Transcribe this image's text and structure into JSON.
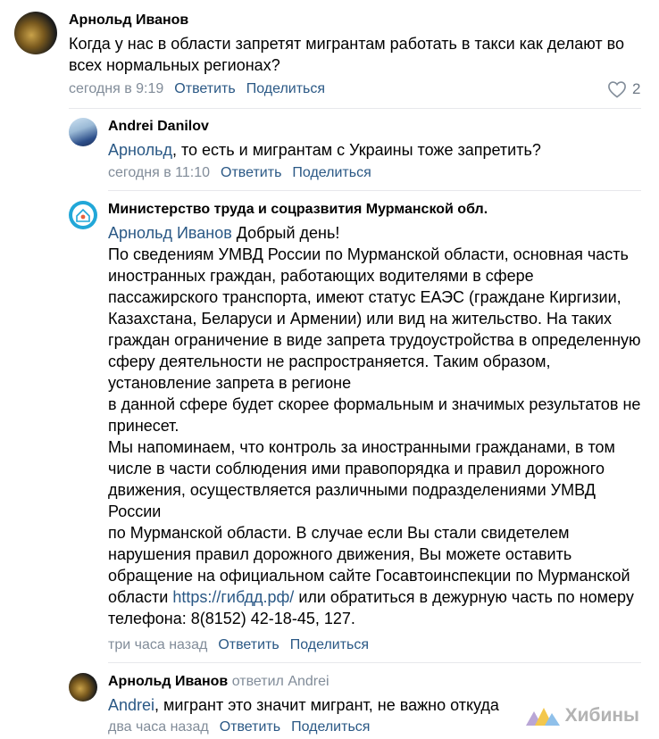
{
  "comments": [
    {
      "author": "Арнольд Иванов",
      "text": "Когда у нас в области запретят мигрантам работать в такси как делают во всех нормальных регионах?",
      "time": "сегодня в 9:19",
      "reply_label": "Ответить",
      "share_label": "Поделиться",
      "likes": "2"
    },
    {
      "author": "Andrei Danilov",
      "mention": "Арнольд",
      "text": ", то есть и мигрантам с Украины тоже запретить?",
      "time": "сегодня в 11:10",
      "reply_label": "Ответить",
      "share_label": "Поделиться"
    },
    {
      "author": "Министерство труда и соцразвития Мурманской обл.",
      "mention": "Арнольд Иванов",
      "greeting": " Добрый день!",
      "para1": "По сведениям УМВД России по Мурманской области, основная часть иностранных граждан, работающих водителями в сфере пассажирского транспорта, имеют статус ЕАЭС (граждане Киргизии, Казахстана, Беларуси и Армении) или вид на жительство. На таких граждан ограничение в виде запрета трудоустройства в определенную сферу деятельности не распространяется. Таким образом, установление запрета в регионе",
      "para2": "в данной сфере будет скорее формальным и значимых результатов не принесет.",
      "para3": "Мы напоминаем, что контроль за иностранными гражданами, в том числе в части соблюдения ими правопорядка и правил дорожного движения, осуществляется различными подразделениями УМВД России",
      "para4_a": "по Мурманской области. В случае если Вы стали свидетелем нарушения правил дорожного движения, Вы можете оставить обращение на официальном сайте Госавтоинспекции по Мурманской области ",
      "para4_link": "https://гибдд.рф/",
      "para4_b": " или обратиться в дежурную часть по номеру телефона: 8(8152) 42-18-45, 127.",
      "time": "три часа назад",
      "reply_label": "Ответить",
      "share_label": "Поделиться"
    },
    {
      "author": "Арнольд Иванов",
      "replied_to": "ответил Andrei",
      "mention": "Andrei",
      "text": ", мигрант это значит мигрант, не важно откуда",
      "time": "два часа назад",
      "reply_label": "Ответить",
      "share_label": "Поделиться"
    }
  ],
  "watermark": "Хибины",
  "colors": {
    "link": "#2a5885",
    "meta": "#818c99",
    "separator": "#e7e8ec"
  }
}
